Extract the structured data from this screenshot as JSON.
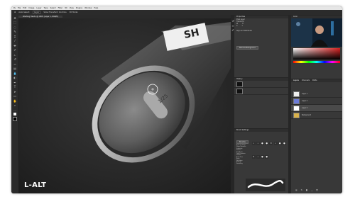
{
  "menubar": {
    "items": [
      "Ps",
      "File",
      "Edit",
      "Image",
      "Layer",
      "Type",
      "Select",
      "Filter",
      "3D",
      "View",
      "Plugins",
      "Window",
      "Help"
    ]
  },
  "options_bar": {
    "items": [
      "Auto-Select:",
      "Layer",
      "Show Transform Controls",
      "3D Mode:"
    ]
  },
  "document": {
    "active_tab": "Washing Hands @ 100% (Layer 1, RGB/8)",
    "label": "L-ALT",
    "printed_text": "SH"
  },
  "panels": {
    "properties": {
      "title": "Properties",
      "rows": [
        "Pixel Layer",
        "Transform",
        "W",
        "H",
        "X",
        "Y",
        "Align and Distribute"
      ],
      "button": "Remove Background"
    },
    "history": {
      "title": "History"
    },
    "brush_settings": {
      "title": "Brush Settings",
      "button": "Brushes",
      "options": [
        "Brush Tip Shape",
        "Shape Dynamics",
        "Scattering",
        "Texture",
        "Dual Brush",
        "Color Dynamics",
        "Transfer",
        "Brush Pose",
        "Noise",
        "Wet Edges",
        "Build-up",
        "Smoothing"
      ]
    },
    "color": {
      "title": "Color"
    },
    "layers": {
      "title": "Layers",
      "tabs": [
        "Layers",
        "Channels",
        "Paths"
      ],
      "items": [
        "Layer 1",
        "Layer 2",
        "Layer 3",
        "Background"
      ]
    }
  },
  "colors": {
    "accent": "#31a8ff"
  }
}
